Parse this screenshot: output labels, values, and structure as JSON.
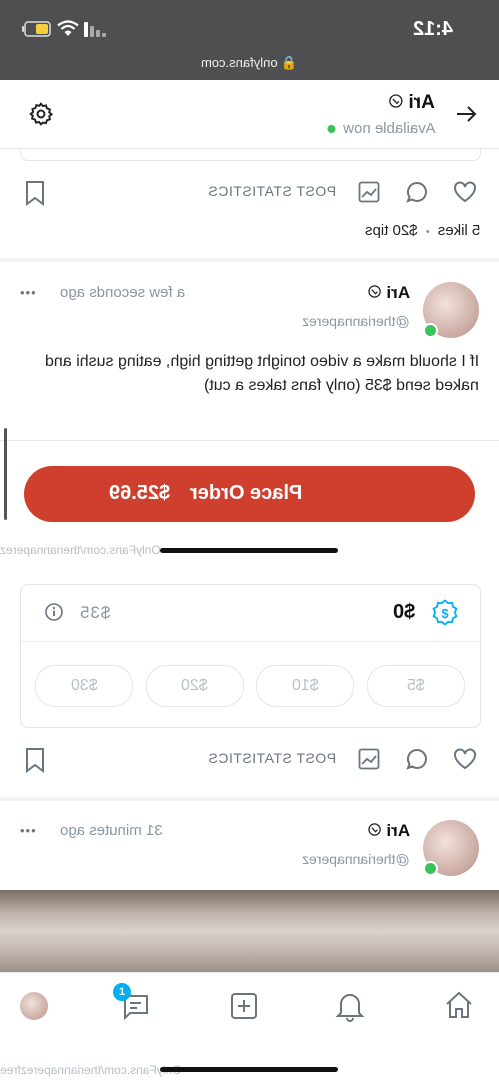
{
  "status_bar": {
    "time": "4:12",
    "url": "onlyfans.com"
  },
  "header": {
    "name": "Ari",
    "status": "Available now"
  },
  "post1": {
    "actions": {
      "stats_label": "POST STATISTICS"
    },
    "likes": "5 likes",
    "dot": "•",
    "tips": "$20 tips"
  },
  "post2": {
    "name": "Ari",
    "handle": "@theriannaperez",
    "time": "a few seconds ago",
    "more": "•••",
    "text_line1": "If I should make a video tonight getting high, eating sushi and",
    "text_line2": "naked send $35 (only fans takes a cut)"
  },
  "order": {
    "label": "Place Order",
    "amount": "$25.69"
  },
  "watermark1": "OnlyFans.com/theriannaperez",
  "tip_card": {
    "current": "$0",
    "goal": "$35",
    "chips": [
      "$5",
      "$10",
      "$20",
      "$30"
    ]
  },
  "post3": {
    "actions": {
      "stats_label": "POST STATISTICS"
    },
    "name": "Ari",
    "handle": "@theriannaperez",
    "time": "31 minutes ago",
    "more": "•••"
  },
  "bottom_nav": {
    "messages_badge": "1"
  },
  "watermark2": "OnlyFans.com/theriannaperezfree",
  "colors": {
    "accent": "#00aff0",
    "order_button": "#cf3f2e",
    "online": "#3bc35b"
  }
}
